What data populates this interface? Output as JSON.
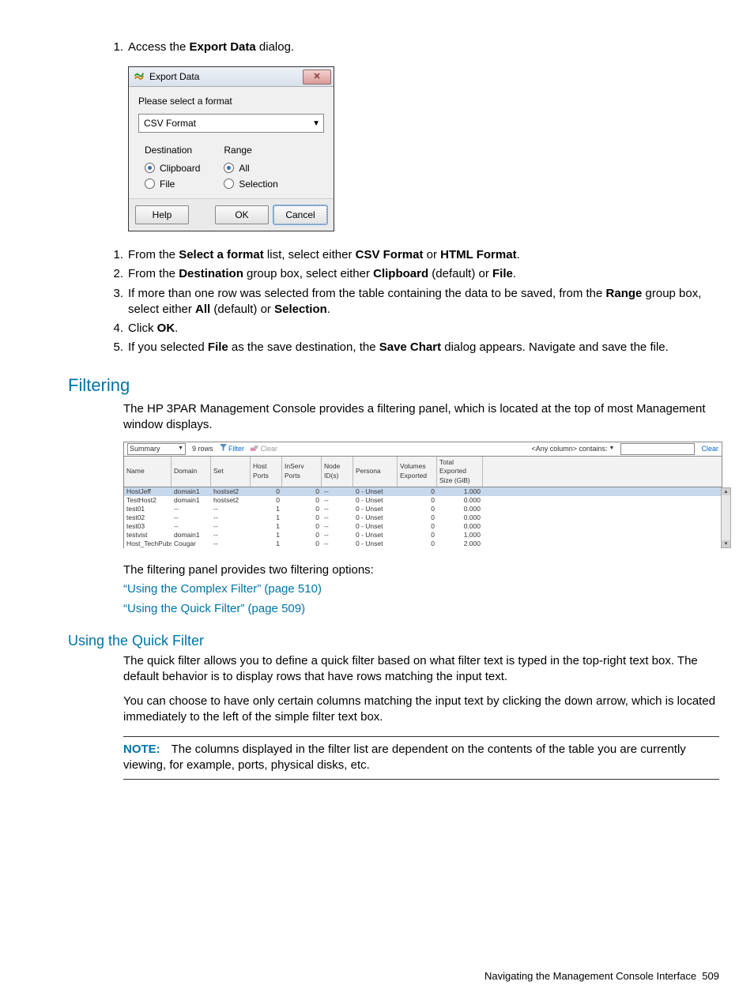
{
  "steps_part1": [
    {
      "pre": "Access the ",
      "b1": "Export Data",
      "post": " dialog."
    }
  ],
  "dialog": {
    "title": "Export Data",
    "prompt": "Please select a format",
    "combo_value": "CSV Format",
    "group_dest": {
      "title": "Destination",
      "opt1": "Clipboard",
      "opt2": "File"
    },
    "group_range": {
      "title": "Range",
      "opt1": "All",
      "opt2": "Selection"
    },
    "buttons": {
      "help": "Help",
      "ok": "OK",
      "cancel": "Cancel"
    }
  },
  "steps_part2": [
    "From the |Select a format| list, select either |CSV Format| or |HTML Format|.",
    "From the |Destination| group box, select either |Clipboard| (default) or |File|.",
    "If more than one row was selected from the table containing the data to be saved, from the |Range| group box, select either |All| (default) or |Selection|.",
    "Click |OK|.",
    "If you selected |File| as the save destination, the |Save Chart| dialog appears. Navigate and save the file."
  ],
  "filtering": {
    "heading": "Filtering",
    "intro": "The HP 3PAR Management Console provides a filtering panel, which is located at the top of most Management window displays.",
    "panel": {
      "view": "Summary",
      "rows_label": "9 rows",
      "filter": "Filter",
      "clear": "Clear",
      "anycol": "<Any column> contains:",
      "clear2": "Clear",
      "columns": [
        "Name",
        "Domain",
        "Set",
        "Host Ports",
        "InServ Ports",
        "Node ID(s)",
        "Persona",
        "Volumes Exported",
        "Total Exported Size (GiB)"
      ],
      "data": [
        [
          "HostJeff",
          "domain1",
          "hostset2",
          "0",
          "0",
          "--",
          "0 - Unset",
          "0",
          "1.000"
        ],
        [
          "TestHost2",
          "domain1",
          "hostset2",
          "0",
          "0",
          "--",
          "0 - Unset",
          "0",
          "0.000"
        ],
        [
          "test01",
          "--",
          "--",
          "1",
          "0",
          "--",
          "0 - Unset",
          "0",
          "0.000"
        ],
        [
          "test02",
          "--",
          "--",
          "1",
          "0",
          "--",
          "0 - Unset",
          "0",
          "0.000"
        ],
        [
          "test03",
          "--",
          "--",
          "1",
          "0",
          "--",
          "0 - Unset",
          "0",
          "0.000"
        ],
        [
          "testvist",
          "domain1",
          "--",
          "1",
          "0",
          "--",
          "0 - Unset",
          "0",
          "1.000"
        ],
        [
          "Host_TechPubs",
          "Cougar",
          "--",
          "1",
          "0",
          "--",
          "0 - Unset",
          "0",
          "2.000"
        ]
      ]
    },
    "after_panel": "The filtering panel provides two filtering options:",
    "link1": "“Using the Complex Filter” (page 510)",
    "link2": "“Using the Quick Filter” (page 509)"
  },
  "quick": {
    "heading": "Using the Quick Filter",
    "p1": "The quick filter allows you to define a quick filter based on what filter text is typed in the top-right text box. The default behavior is to display rows that have rows matching the input text.",
    "p2": "You can choose to have only certain columns matching the input text by clicking the down arrow, which is located immediately to the left of the simple filter text box.",
    "note_label": "NOTE:",
    "note": "The columns displayed in the filter list are dependent on the contents of the table you are currently viewing, for example, ports, physical disks, etc."
  },
  "footer": {
    "text": "Navigating the Management Console Interface",
    "page": "509"
  }
}
